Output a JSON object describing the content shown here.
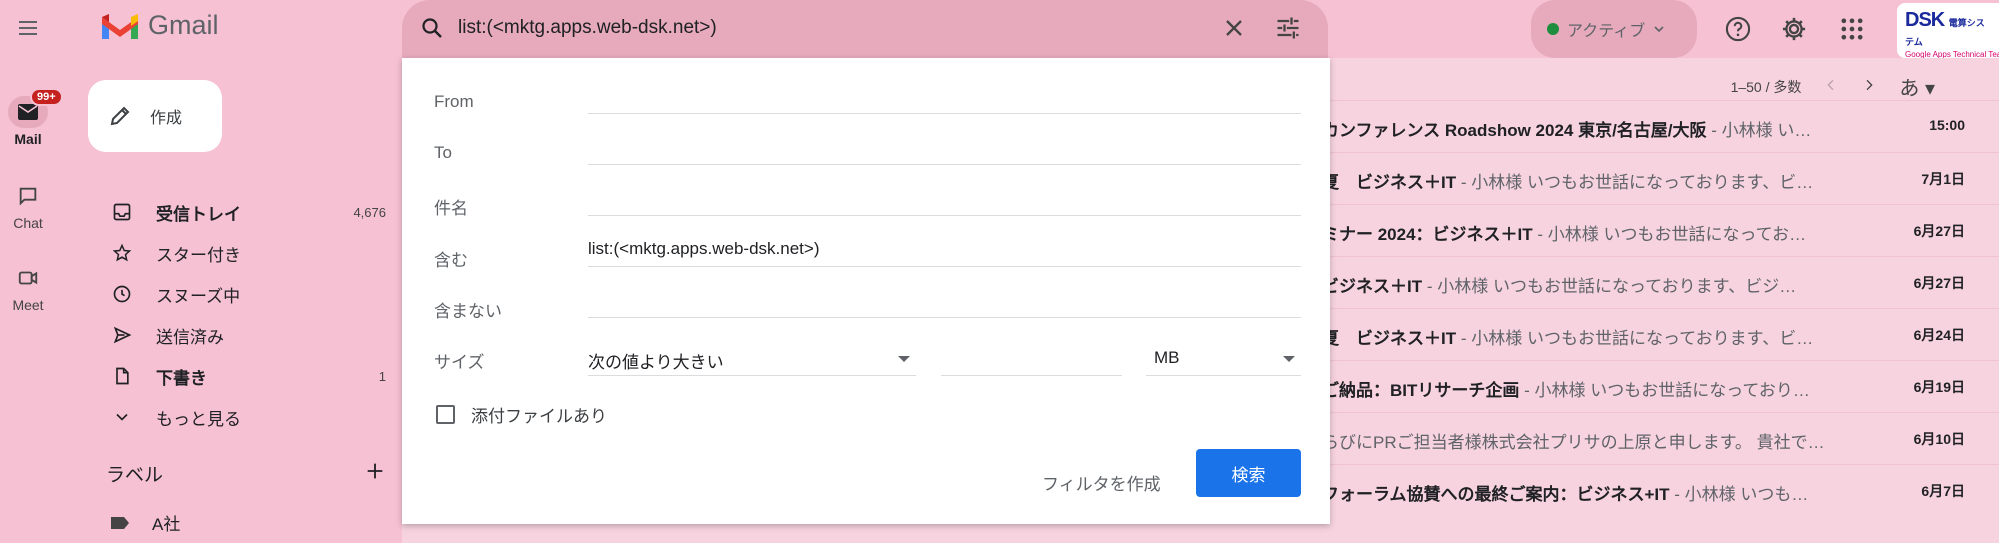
{
  "header": {
    "app_name": "Gmail",
    "search_value": "list:(<mktg.apps.web-dsk.net>)",
    "status_label": "アクティブ",
    "account_logo_text": "DSK",
    "account_logo_jp": "電算システム",
    "account_sub": "Google Apps Technical Team"
  },
  "rail": {
    "mail_label": "Mail",
    "mail_badge": "99+",
    "chat_label": "Chat",
    "meet_label": "Meet"
  },
  "sidebar": {
    "compose_label": "作成",
    "items": [
      {
        "label": "受信トレイ",
        "count": "4,676",
        "icon": "inbox-icon"
      },
      {
        "label": "スター付き",
        "count": "",
        "icon": "star-icon"
      },
      {
        "label": "スヌーズ中",
        "count": "",
        "icon": "clock-icon"
      },
      {
        "label": "送信済み",
        "count": "",
        "icon": "send-icon"
      },
      {
        "label": "下書き",
        "count": "1",
        "icon": "draft-icon"
      },
      {
        "label": "もっと見る",
        "count": "",
        "icon": "chevron-down-icon"
      }
    ],
    "labels_header": "ラベル",
    "label_item": "A社"
  },
  "toolbar": {
    "range": "1–50 / 多数",
    "input_tool": "あ"
  },
  "emails": [
    {
      "subject": "カンファレンス Roadshow 2024 東京/名古屋/大阪",
      "snippet": " - 小林様 い…",
      "date": "15:00"
    },
    {
      "subject": "夏　ビジネス＋IT",
      "snippet": " - 小林様 いつもお世話になっております、ビ…",
      "date": "7月1日"
    },
    {
      "subject": "ミナー 2024：ビジネス＋IT",
      "snippet": " - 小林様 いつもお世話になってお…",
      "date": "6月27日"
    },
    {
      "subject": " ビジネス＋IT",
      "snippet": " - 小林様 いつもお世話になっております、ビジ…",
      "date": "6月27日"
    },
    {
      "subject": "夏　ビジネス＋IT",
      "snippet": " - 小林様 いつもお世話になっております、ビ…",
      "date": "6月24日"
    },
    {
      "subject": "ご納品：BITリサーチ企画",
      "snippet": " - 小林様 いつもお世話になっており…",
      "date": "6月19日"
    },
    {
      "subject": "",
      "snippet": "らびにPRご担当者様株式会社プリサの上原と申します。 貴社で…",
      "date": "6月10日"
    },
    {
      "subject": "フォーラム協賛への最終ご案内：ビジネス+IT",
      "snippet": " - 小林様 いつも…",
      "date": "6月7日"
    }
  ],
  "search_panel": {
    "from_label": "From",
    "to_label": "To",
    "subject_label": "件名",
    "has_words_label": "含む",
    "has_words_value": "list:(<mktg.apps.web-dsk.net>)",
    "no_words_label": "含まない",
    "size_label": "サイズ",
    "size_operator": "次の値より大きい",
    "size_unit": "MB",
    "attachment_label": "添付ファイルあり",
    "create_filter_label": "フィルタを作成",
    "search_button_label": "検索"
  }
}
